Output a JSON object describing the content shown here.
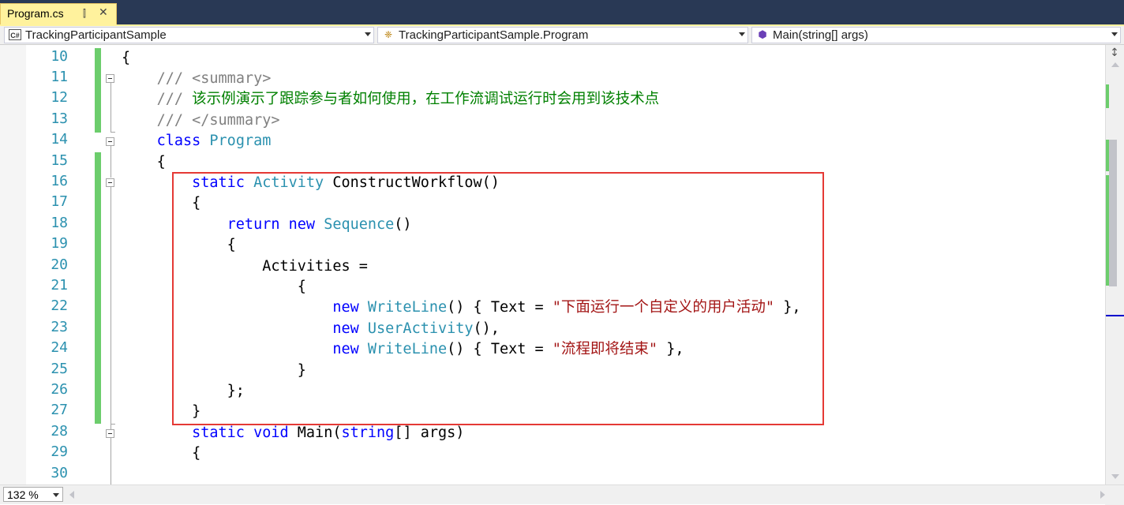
{
  "tab": {
    "title": "Program.cs",
    "pin_icon": "pin-icon",
    "close_icon": "close-icon"
  },
  "nav": {
    "project": "TrackingParticipantSample",
    "project_icon_text": "C#",
    "class": "TrackingParticipantSample.Program",
    "member": "Main(string[] args)"
  },
  "line_numbers": [
    "10",
    "11",
    "12",
    "13",
    "14",
    "15",
    "16",
    "17",
    "18",
    "19",
    "20",
    "21",
    "22",
    "23",
    "24",
    "25",
    "26",
    "27",
    "28",
    "29",
    "30"
  ],
  "code": {
    "l10": {
      "brace": "{"
    },
    "l11": {
      "indent": "    ",
      "slashes": "/// ",
      "tag": "<summary>"
    },
    "l12": {
      "indent": "    ",
      "slashes": "/// ",
      "text": "该示例演示了跟踪参与者如何使用，在工作流调试运行时会用到该技术点"
    },
    "l13": {
      "indent": "    ",
      "slashes": "/// ",
      "tag": "</summary>"
    },
    "l14": {
      "indent": "    ",
      "kw": "class",
      "sp": " ",
      "type": "Program"
    },
    "l15": {
      "indent": "    ",
      "brace": "{"
    },
    "l16": {
      "indent": "        ",
      "kw": "static",
      "sp1": " ",
      "type": "Activity",
      "sp2": " ",
      "rest": "ConstructWorkflow()"
    },
    "l17": {
      "indent": "        ",
      "brace": "{"
    },
    "l18": {
      "indent": "            ",
      "kw1": "return",
      "sp1": " ",
      "kw2": "new",
      "sp2": " ",
      "type": "Sequence",
      "rest": "()"
    },
    "l19": {
      "indent": "            ",
      "brace": "{"
    },
    "l20": {
      "indent": "                ",
      "text": "Activities ="
    },
    "l21": {
      "indent": "                    ",
      "brace": "{"
    },
    "l22": {
      "indent": "                        ",
      "kw": "new",
      "sp": " ",
      "type": "WriteLine",
      "mid": "() { Text = ",
      "str": "\"下面运行一个自定义的用户活动\"",
      "end": " },"
    },
    "l23": {
      "indent": "                        ",
      "kw": "new",
      "sp": " ",
      "type": "UserActivity",
      "end": "(),"
    },
    "l24": {
      "indent": "                        ",
      "kw": "new",
      "sp": " ",
      "type": "WriteLine",
      "mid": "() { Text = ",
      "str": "\"流程即将结束\"",
      "end": " },"
    },
    "l25": {
      "indent": "                    ",
      "brace": "}"
    },
    "l26": {
      "indent": "            ",
      "text": "};"
    },
    "l27": {
      "indent": "        ",
      "brace": "}"
    },
    "l28": {
      "indent": "        ",
      "kw1": "static",
      "sp1": " ",
      "kw2": "void",
      "sp2": " ",
      "name": "Main(",
      "kw3": "string",
      "rest": "[] args)"
    },
    "l29": {
      "indent": "        ",
      "brace": "{"
    }
  },
  "zoom": "132 %",
  "colors": {
    "keyword": "#0000ff",
    "type": "#2b91af",
    "comment": "#008000",
    "string": "#a31515",
    "highlight_box": "#e53935",
    "change_bar": "#6ccd6c",
    "tab_active": "#fff29d",
    "tab_strip": "#293955"
  }
}
